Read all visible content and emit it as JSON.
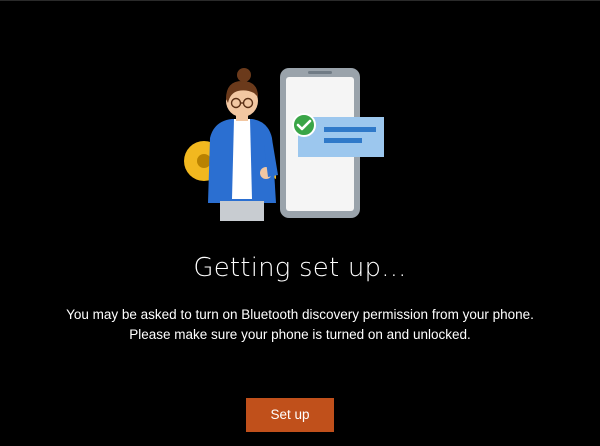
{
  "screen": {
    "title": "Getting set up...",
    "description_line1": "You may be asked to turn on Bluetooth discovery permission from your phone.",
    "description_line2": "Please make sure your phone is turned on and unlocked."
  },
  "actions": {
    "setup_label": "Set up"
  },
  "illustration": {
    "name": "person-with-key-and-phone",
    "check_icon": "checkmark-icon"
  },
  "colors": {
    "background": "#000000",
    "primary_button": "#c0501b",
    "text": "#ffffff"
  }
}
